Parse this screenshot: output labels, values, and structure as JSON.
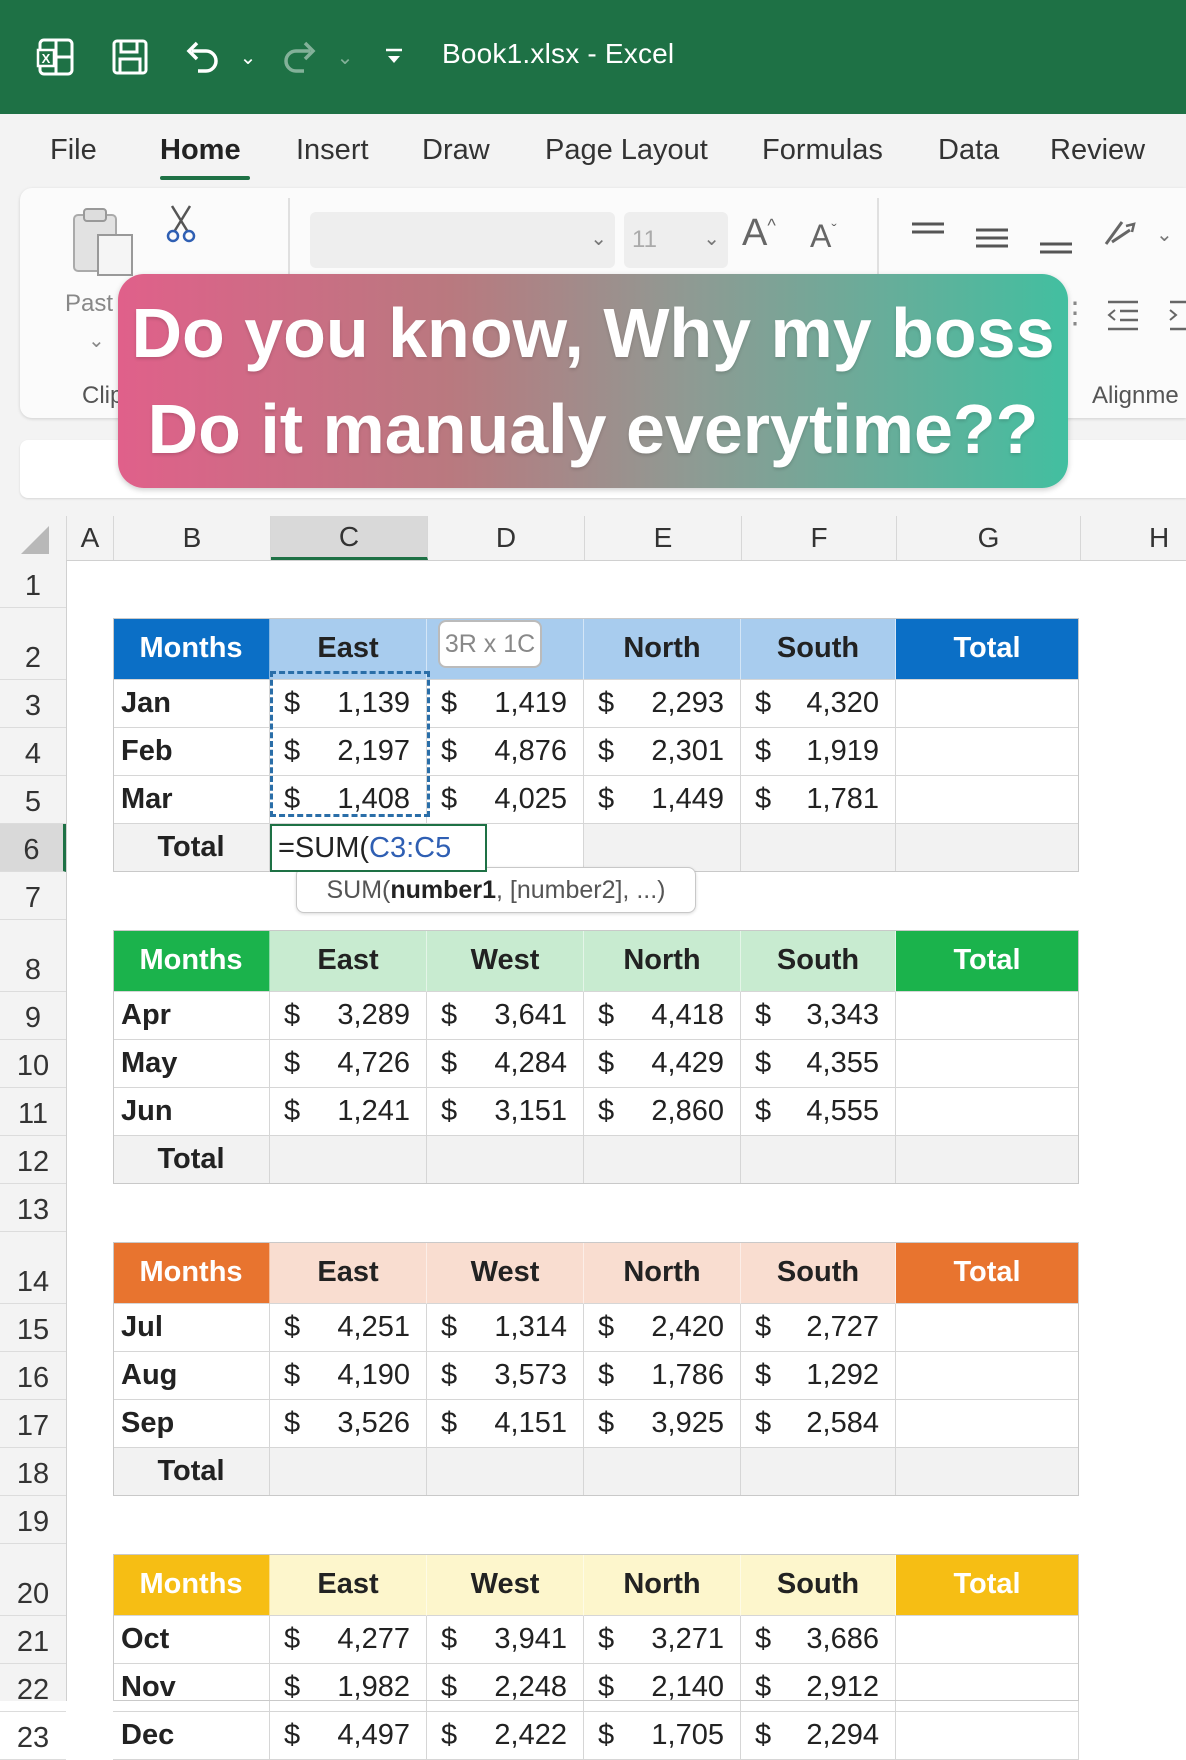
{
  "titlebar": {
    "title": "Book1.xlsx  -  Excel"
  },
  "menu": {
    "items": [
      "File",
      "Home",
      "Insert",
      "Draw",
      "Page Layout",
      "Formulas",
      "Data",
      "Review"
    ]
  },
  "ribbon": {
    "paste_label": "Past",
    "clipboard_label": "Clip",
    "alignment_label": "Alignme",
    "font_size": "11"
  },
  "overlay": {
    "line1": "Do you know, Why my boss",
    "line2": "Do it manualy everytime??"
  },
  "columns": [
    "A",
    "B",
    "C",
    "D",
    "E",
    "F",
    "G",
    "H"
  ],
  "rows": [
    "1",
    "2",
    "3",
    "4",
    "5",
    "6",
    "7",
    "8",
    "9",
    "10",
    "11",
    "12",
    "13",
    "14",
    "15",
    "16",
    "17",
    "18",
    "19",
    "20",
    "21",
    "22",
    "23"
  ],
  "formula": {
    "prefix": "=SUM(",
    "range": "C3:C5",
    "size_hint": "3R x 1C",
    "fn_hint_name": "SUM(",
    "fn_hint_arg1": "number1",
    "fn_hint_rest": ", [number2], ...)"
  },
  "tables": [
    {
      "header": [
        "Months",
        "East",
        "",
        "North",
        "South",
        "Total"
      ],
      "accent": "#0b6fc6",
      "light": "#a8ccee",
      "rows": [
        {
          "month": "Jan",
          "values": [
            "1,139",
            "1,419",
            "2,293",
            "4,320"
          ]
        },
        {
          "month": "Feb",
          "values": [
            "2,197",
            "4,876",
            "2,301",
            "1,919"
          ]
        },
        {
          "month": "Mar",
          "values": [
            "1,408",
            "4,025",
            "1,449",
            "1,781"
          ]
        }
      ],
      "total_label": "Total"
    },
    {
      "header": [
        "Months",
        "East",
        "West",
        "North",
        "South",
        "Total"
      ],
      "accent": "#1bb34c",
      "light": "#c8ebd0",
      "rows": [
        {
          "month": "Apr",
          "values": [
            "3,289",
            "3,641",
            "4,418",
            "3,343"
          ]
        },
        {
          "month": "May",
          "values": [
            "4,726",
            "4,284",
            "4,429",
            "4,355"
          ]
        },
        {
          "month": "Jun",
          "values": [
            "1,241",
            "3,151",
            "2,860",
            "4,555"
          ]
        }
      ],
      "total_label": "Total"
    },
    {
      "header": [
        "Months",
        "East",
        "West",
        "North",
        "South",
        "Total"
      ],
      "accent": "#e8742f",
      "light": "#f9ddd0",
      "rows": [
        {
          "month": "Jul",
          "values": [
            "4,251",
            "1,314",
            "2,420",
            "2,727"
          ]
        },
        {
          "month": "Aug",
          "values": [
            "4,190",
            "3,573",
            "1,786",
            "1,292"
          ]
        },
        {
          "month": "Sep",
          "values": [
            "3,526",
            "4,151",
            "3,925",
            "2,584"
          ]
        }
      ],
      "total_label": "Total"
    },
    {
      "header": [
        "Months",
        "East",
        "West",
        "North",
        "South",
        "Total"
      ],
      "accent": "#f6be14",
      "light": "#fdf6cc",
      "rows": [
        {
          "month": "Oct",
          "values": [
            "4,277",
            "3,941",
            "3,271",
            "3,686"
          ]
        },
        {
          "month": "Nov",
          "values": [
            "1,982",
            "2,248",
            "2,140",
            "2,912"
          ]
        },
        {
          "month": "Dec",
          "values": [
            "4,497",
            "2,422",
            "1,705",
            "2,294"
          ]
        }
      ],
      "total_label": "Total"
    }
  ],
  "currency": "$"
}
